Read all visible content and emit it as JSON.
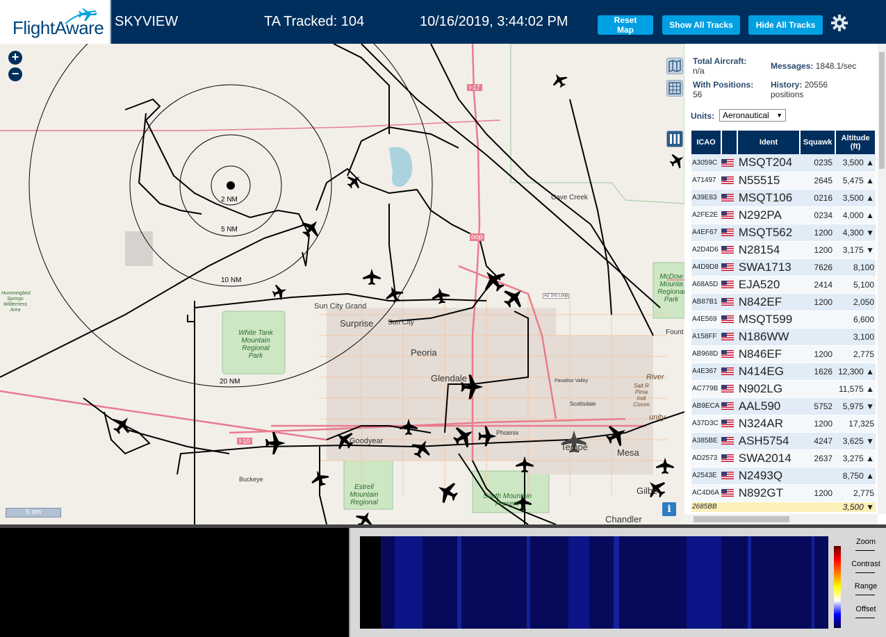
{
  "header": {
    "logo_text": "FlightAware",
    "app_name": "SKYVIEW",
    "tracked": "TA Tracked: 104",
    "datetime": "10/16/2019, 3:44:02 PM",
    "buttons": {
      "reset": "Reset Map",
      "show_all": "Show All Tracks",
      "hide_all": "Hide All Tracks"
    },
    "settings_icon": "gear-icon",
    "brand_color": "#002f5d",
    "button_color": "#00a0e2"
  },
  "map": {
    "zoom_in": "+",
    "zoom_out": "−",
    "scale_label": "5 nm",
    "info_label": "i",
    "ring_labels": [
      "2 NM",
      "5 NM",
      "10 NM",
      "20 NM"
    ],
    "places": {
      "cave_creek": "Cave Creek",
      "sun_city_grand": "Sun City Grand",
      "surprise": "Surprise",
      "sun_city": "Sun City",
      "peoria": "Peoria",
      "glendale": "Glendale",
      "goodyear": "Goodyear",
      "buckeye": "Buckeye",
      "phoenix": "Phoenix",
      "tempe": "Tempe",
      "mesa": "Mesa",
      "chandler": "Chandler",
      "gilbert": "Gilbe",
      "scottsdale": "Scottsdale",
      "paradise_valley": "Paradise Valley",
      "fountain": "Fount",
      "loop": "oop",
      "i17_top": "I-17",
      "i10": "I-10",
      "az101": "AZ 101 Loop",
      "mcdowell": "McDow Mounta Regional Park",
      "white_tank": "White Tank Mountain Regional Park",
      "estrella": "Estrell Mountain Regional",
      "south_mountain": "South Mountain Preserv",
      "hummingbird": "Hummingbird Springs Wilderness Area",
      "river": "River",
      "salt_river": "Salt R Pima Indi Comm",
      "unity": "unity"
    }
  },
  "sidebar": {
    "total_aircraft_label": "Total Aircraft:",
    "total_aircraft_value": "n/a",
    "with_positions_label": "With Positions:",
    "with_positions_value": "56",
    "messages_label": "Messages:",
    "messages_value": "1848.1/sec",
    "history_label": "History:",
    "history_value": "20556 positions",
    "units_label": "Units:",
    "units_value": "Aeronautical",
    "columns": [
      "ICAO",
      "",
      "Ident",
      "Squawk",
      "Altitude (ft)"
    ],
    "rows": [
      {
        "icao": "A3059C",
        "ident": "MSQT204",
        "squawk": "0235",
        "altitude": "3,500 ▲"
      },
      {
        "icao": "A71497",
        "ident": "N55515",
        "squawk": "2645",
        "altitude": "5,475 ▲"
      },
      {
        "icao": "A39E83",
        "ident": "MSQT106",
        "squawk": "0216",
        "altitude": "3,500 ▲"
      },
      {
        "icao": "A2FE2E",
        "ident": "N292PA",
        "squawk": "0234",
        "altitude": "4,000 ▲"
      },
      {
        "icao": "A4EF67",
        "ident": "MSQT562",
        "squawk": "1200",
        "altitude": "4,300 ▼"
      },
      {
        "icao": "A2D4D6",
        "ident": "N28154",
        "squawk": "1200",
        "altitude": "3,175 ▼"
      },
      {
        "icao": "A4D9D8",
        "ident": "SWA1713",
        "squawk": "7626",
        "altitude": "8,100"
      },
      {
        "icao": "A68A5D",
        "ident": "EJA520",
        "squawk": "2414",
        "altitude": "5,100"
      },
      {
        "icao": "AB87B1",
        "ident": "N842EF",
        "squawk": "1200",
        "altitude": "2,050"
      },
      {
        "icao": "A4E569",
        "ident": "MSQT599",
        "squawk": "",
        "altitude": "6,600"
      },
      {
        "icao": "A158FF",
        "ident": "N186WW",
        "squawk": "",
        "altitude": "3,100"
      },
      {
        "icao": "AB968D",
        "ident": "N846EF",
        "squawk": "1200",
        "altitude": "2,775"
      },
      {
        "icao": "A4E367",
        "ident": "N414EG",
        "squawk": "1626",
        "altitude": "12,300 ▲"
      },
      {
        "icao": "AC779B",
        "ident": "N902LG",
        "squawk": "",
        "altitude": "11,575 ▲"
      },
      {
        "icao": "AB9ECA",
        "ident": "AAL590",
        "squawk": "5752",
        "altitude": "5,975 ▼"
      },
      {
        "icao": "A37D3C",
        "ident": "N324AR",
        "squawk": "1200",
        "altitude": "17,325"
      },
      {
        "icao": "A385BE",
        "ident": "ASH5754",
        "squawk": "4247",
        "altitude": "3,625 ▼"
      },
      {
        "icao": "AD2573",
        "ident": "SWA2014",
        "squawk": "2637",
        "altitude": "3,275 ▲"
      },
      {
        "icao": "A2543E",
        "ident": "N2493Q",
        "squawk": "",
        "altitude": "8,750 ▲"
      },
      {
        "icao": "AC4D6A",
        "ident": "N892GT",
        "squawk": "1200",
        "altitude": "2,775"
      },
      {
        "icao": "2685BB",
        "ident": "",
        "squawk": "",
        "altitude": "3,500 ▼"
      }
    ]
  },
  "spectrum": {
    "zoom": "Zoom",
    "contrast": "Contrast",
    "range": "Range",
    "offset": "Offset"
  }
}
